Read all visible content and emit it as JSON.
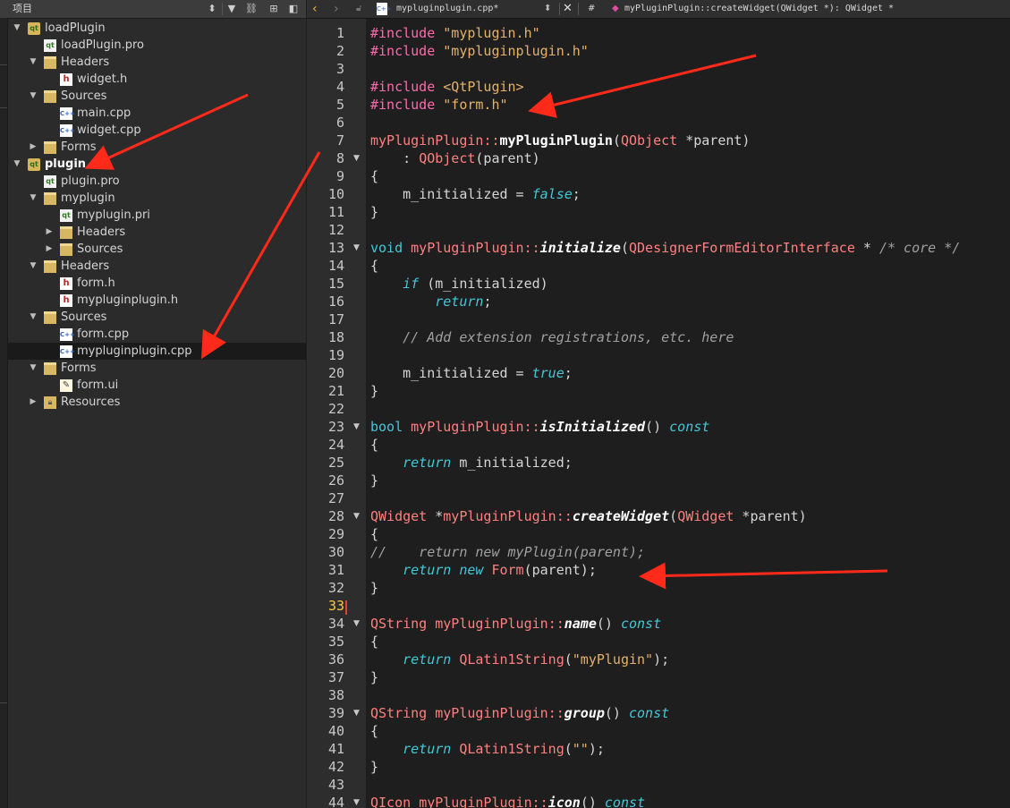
{
  "project_panel": {
    "title": "项目",
    "tree": [
      {
        "label": "loadPlugin",
        "icon": "qt-project-icon",
        "expanded": true,
        "level": 0,
        "bold": false
      },
      {
        "label": "loadPlugin.pro",
        "icon": "pro-file-icon",
        "level": 1
      },
      {
        "label": "Headers",
        "icon": "header-folder-icon",
        "expanded": true,
        "level": 1
      },
      {
        "label": "widget.h",
        "icon": "header-file-icon",
        "level": 2
      },
      {
        "label": "Sources",
        "icon": "source-folder-icon",
        "expanded": true,
        "level": 1
      },
      {
        "label": "main.cpp",
        "icon": "cpp-file-icon",
        "level": 2
      },
      {
        "label": "widget.cpp",
        "icon": "cpp-file-icon",
        "level": 2
      },
      {
        "label": "Forms",
        "icon": "forms-folder-icon",
        "expanded": false,
        "level": 1
      },
      {
        "label": "plugin",
        "icon": "qt-project-icon",
        "expanded": true,
        "level": 0,
        "bold": true
      },
      {
        "label": "plugin.pro",
        "icon": "pro-file-icon",
        "level": 1
      },
      {
        "label": "myplugin",
        "icon": "pri-folder-icon",
        "expanded": true,
        "level": 1
      },
      {
        "label": "myplugin.pri",
        "icon": "pro-file-icon",
        "level": 2
      },
      {
        "label": "Headers",
        "icon": "header-folder-icon",
        "expanded": false,
        "level": 2
      },
      {
        "label": "Sources",
        "icon": "source-folder-icon",
        "expanded": false,
        "level": 2
      },
      {
        "label": "Headers",
        "icon": "header-folder-icon",
        "expanded": true,
        "level": 1
      },
      {
        "label": "form.h",
        "icon": "header-file-icon",
        "level": 2
      },
      {
        "label": "mypluginplugin.h",
        "icon": "header-file-icon",
        "level": 2
      },
      {
        "label": "Sources",
        "icon": "source-folder-icon",
        "expanded": true,
        "level": 1
      },
      {
        "label": "form.cpp",
        "icon": "cpp-file-icon",
        "level": 2
      },
      {
        "label": "mypluginplugin.cpp",
        "icon": "cpp-file-icon",
        "level": 2,
        "selected": true
      },
      {
        "label": "Forms",
        "icon": "forms-folder-icon",
        "expanded": true,
        "level": 1
      },
      {
        "label": "form.ui",
        "icon": "ui-file-icon",
        "level": 2
      },
      {
        "label": "Resources",
        "icon": "resources-folder-icon",
        "expanded": false,
        "level": 1
      }
    ]
  },
  "editor": {
    "file_name": "mypluginplugin.cpp*",
    "hash_label": "#",
    "function_symbol": "myPluginPlugin::createWidget(QWidget *): QWidget *",
    "current_line": 33,
    "lines": [
      {
        "n": 1,
        "tokens": [
          [
            "pre",
            "#include "
          ],
          [
            "str",
            "\"myplugin.h\""
          ]
        ]
      },
      {
        "n": 2,
        "tokens": [
          [
            "pre",
            "#include "
          ],
          [
            "str",
            "\"mypluginplugin.h\""
          ]
        ]
      },
      {
        "n": 3,
        "tokens": []
      },
      {
        "n": 4,
        "tokens": [
          [
            "pre",
            "#include "
          ],
          [
            "str",
            "<QtPlugin>"
          ]
        ]
      },
      {
        "n": 5,
        "tokens": [
          [
            "pre",
            "#include "
          ],
          [
            "str",
            "\"form.h\""
          ]
        ]
      },
      {
        "n": 6,
        "tokens": []
      },
      {
        "n": 7,
        "tokens": [
          [
            "type",
            "myPluginPlugin"
          ],
          [
            "op",
            "::"
          ],
          [
            "fnb",
            "myPluginPlugin"
          ],
          [
            "plain",
            "("
          ],
          [
            "cls",
            "QObject"
          ],
          [
            "plain",
            " *parent)"
          ]
        ]
      },
      {
        "n": 8,
        "fold": true,
        "tokens": [
          [
            "plain",
            "    : "
          ],
          [
            "cls",
            "QObject"
          ],
          [
            "plain",
            "(parent)"
          ]
        ]
      },
      {
        "n": 9,
        "tokens": [
          [
            "plain",
            "{"
          ]
        ]
      },
      {
        "n": 10,
        "tokens": [
          [
            "plain",
            "    m_initialized = "
          ],
          [
            "kw",
            "false"
          ],
          [
            "plain",
            ";"
          ]
        ]
      },
      {
        "n": 11,
        "tokens": [
          [
            "plain",
            "}"
          ]
        ]
      },
      {
        "n": 12,
        "tokens": []
      },
      {
        "n": 13,
        "fold": true,
        "tokens": [
          [
            "kwn",
            "void "
          ],
          [
            "type",
            "myPluginPlugin"
          ],
          [
            "op",
            "::"
          ],
          [
            "fn",
            "initialize"
          ],
          [
            "plain",
            "("
          ],
          [
            "cls",
            "QDesignerFormEditorInterface"
          ],
          [
            "plain",
            " * "
          ],
          [
            "cm",
            "/* core */"
          ]
        ]
      },
      {
        "n": 14,
        "tokens": [
          [
            "plain",
            "{"
          ]
        ]
      },
      {
        "n": 15,
        "tokens": [
          [
            "plain",
            "    "
          ],
          [
            "kw",
            "if"
          ],
          [
            "plain",
            " (m_initialized)"
          ]
        ]
      },
      {
        "n": 16,
        "tokens": [
          [
            "plain",
            "        "
          ],
          [
            "kw",
            "return"
          ],
          [
            "plain",
            ";"
          ]
        ]
      },
      {
        "n": 17,
        "tokens": []
      },
      {
        "n": 18,
        "tokens": [
          [
            "plain",
            "    "
          ],
          [
            "cm",
            "// Add extension registrations, etc. here"
          ]
        ]
      },
      {
        "n": 19,
        "tokens": []
      },
      {
        "n": 20,
        "tokens": [
          [
            "plain",
            "    m_initialized = "
          ],
          [
            "kw",
            "true"
          ],
          [
            "plain",
            ";"
          ]
        ]
      },
      {
        "n": 21,
        "tokens": [
          [
            "plain",
            "}"
          ]
        ]
      },
      {
        "n": 22,
        "tokens": []
      },
      {
        "n": 23,
        "fold": true,
        "tokens": [
          [
            "kwn",
            "bool "
          ],
          [
            "type",
            "myPluginPlugin"
          ],
          [
            "op",
            "::"
          ],
          [
            "fn",
            "isInitialized"
          ],
          [
            "plain",
            "() "
          ],
          [
            "kw",
            "const"
          ]
        ]
      },
      {
        "n": 24,
        "tokens": [
          [
            "plain",
            "{"
          ]
        ]
      },
      {
        "n": 25,
        "tokens": [
          [
            "plain",
            "    "
          ],
          [
            "kw",
            "return"
          ],
          [
            "plain",
            " m_initialized;"
          ]
        ]
      },
      {
        "n": 26,
        "tokens": [
          [
            "plain",
            "}"
          ]
        ]
      },
      {
        "n": 27,
        "tokens": []
      },
      {
        "n": 28,
        "fold": true,
        "tokens": [
          [
            "cls",
            "QWidget"
          ],
          [
            "plain",
            " *"
          ],
          [
            "type",
            "myPluginPlugin"
          ],
          [
            "op",
            "::"
          ],
          [
            "fn",
            "createWidget"
          ],
          [
            "plain",
            "("
          ],
          [
            "cls",
            "QWidget"
          ],
          [
            "plain",
            " *parent)"
          ]
        ]
      },
      {
        "n": 29,
        "tokens": [
          [
            "plain",
            "{"
          ]
        ]
      },
      {
        "n": 30,
        "tokens": [
          [
            "cm",
            "//    return new myPlugin(parent);"
          ]
        ]
      },
      {
        "n": 31,
        "tokens": [
          [
            "plain",
            "    "
          ],
          [
            "kw",
            "return"
          ],
          [
            "plain",
            " "
          ],
          [
            "kw",
            "new"
          ],
          [
            "plain",
            " "
          ],
          [
            "cls",
            "Form"
          ],
          [
            "plain",
            "(parent);"
          ]
        ]
      },
      {
        "n": 32,
        "tokens": [
          [
            "plain",
            "}"
          ]
        ]
      },
      {
        "n": 33,
        "tokens": []
      },
      {
        "n": 34,
        "fold": true,
        "tokens": [
          [
            "cls",
            "QString"
          ],
          [
            "plain",
            " "
          ],
          [
            "type",
            "myPluginPlugin"
          ],
          [
            "op",
            "::"
          ],
          [
            "fn",
            "name"
          ],
          [
            "plain",
            "() "
          ],
          [
            "kw",
            "const"
          ]
        ]
      },
      {
        "n": 35,
        "tokens": [
          [
            "plain",
            "{"
          ]
        ]
      },
      {
        "n": 36,
        "tokens": [
          [
            "plain",
            "    "
          ],
          [
            "kw",
            "return"
          ],
          [
            "plain",
            " "
          ],
          [
            "cls",
            "QLatin1String"
          ],
          [
            "plain",
            "("
          ],
          [
            "str",
            "\"myPlugin\""
          ],
          [
            "plain",
            ");"
          ]
        ]
      },
      {
        "n": 37,
        "tokens": [
          [
            "plain",
            "}"
          ]
        ]
      },
      {
        "n": 38,
        "tokens": []
      },
      {
        "n": 39,
        "fold": true,
        "tokens": [
          [
            "cls",
            "QString"
          ],
          [
            "plain",
            " "
          ],
          [
            "type",
            "myPluginPlugin"
          ],
          [
            "op",
            "::"
          ],
          [
            "fn",
            "group"
          ],
          [
            "plain",
            "() "
          ],
          [
            "kw",
            "const"
          ]
        ]
      },
      {
        "n": 40,
        "tokens": [
          [
            "plain",
            "{"
          ]
        ]
      },
      {
        "n": 41,
        "tokens": [
          [
            "plain",
            "    "
          ],
          [
            "kw",
            "return"
          ],
          [
            "plain",
            " "
          ],
          [
            "cls",
            "QLatin1String"
          ],
          [
            "plain",
            "("
          ],
          [
            "str",
            "\"\""
          ],
          [
            "plain",
            ");"
          ]
        ]
      },
      {
        "n": 42,
        "tokens": [
          [
            "plain",
            "}"
          ]
        ]
      },
      {
        "n": 43,
        "tokens": []
      },
      {
        "n": 44,
        "fold": true,
        "tokens": [
          [
            "cls",
            "QIcon"
          ],
          [
            "plain",
            " "
          ],
          [
            "type",
            "myPluginPlugin"
          ],
          [
            "op",
            "::"
          ],
          [
            "fn",
            "icon"
          ],
          [
            "plain",
            "() "
          ],
          [
            "kw",
            "const"
          ]
        ]
      }
    ]
  },
  "colors": {
    "annotation_arrow": "#ff2a1a",
    "background": "#1e1e1e",
    "sidebar": "#2b2b2b"
  }
}
